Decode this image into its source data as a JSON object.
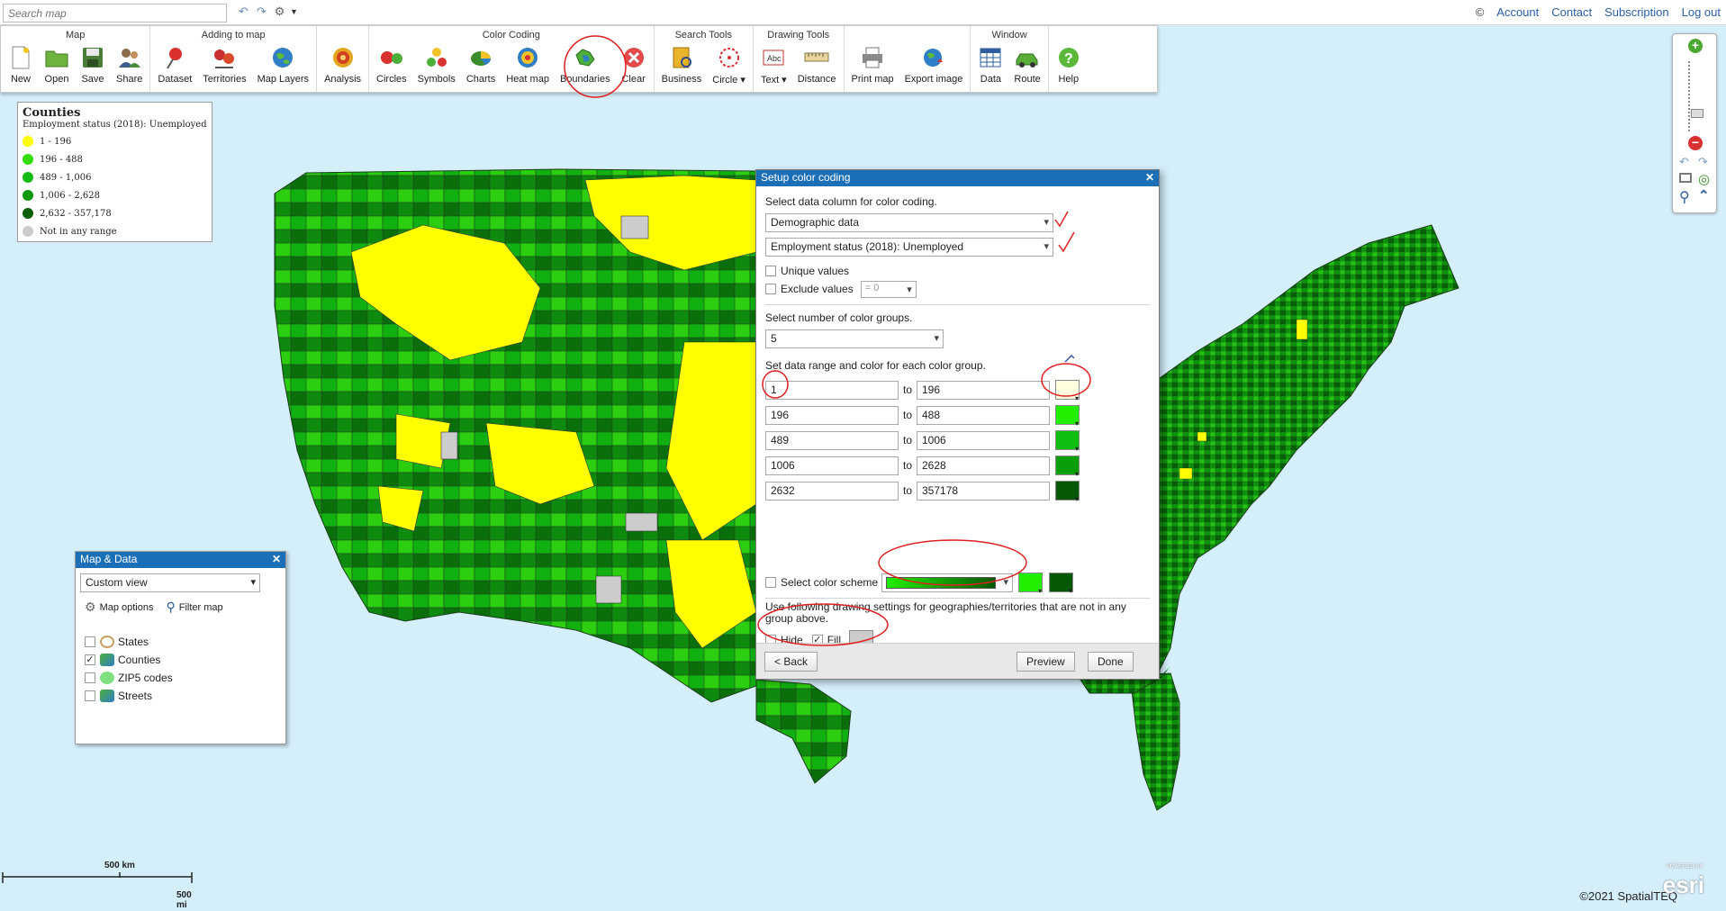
{
  "topbar": {
    "search_placeholder": "Search map",
    "copyright_symbol": "©",
    "links": [
      "Account",
      "Contact",
      "Subscription",
      "Log out"
    ]
  },
  "ribbon": {
    "groups": [
      {
        "title": "Map",
        "buttons": [
          "New",
          "Open",
          "Save",
          "Share"
        ]
      },
      {
        "title": "Adding to map",
        "buttons": [
          "Dataset",
          "Territories",
          "Map Layers"
        ]
      },
      {
        "title": "",
        "buttons": [
          "Analysis"
        ]
      },
      {
        "title": "Color Coding",
        "buttons": [
          "Circles",
          "Symbols",
          "Charts",
          "Heat map",
          "Boundaries",
          "Clear"
        ]
      },
      {
        "title": "Search Tools",
        "buttons": [
          "Business",
          "Circle ▾"
        ]
      },
      {
        "title": "Drawing Tools",
        "buttons": [
          "Text ▾",
          "Distance"
        ]
      },
      {
        "title": "",
        "buttons": [
          "Print map",
          "Export image"
        ]
      },
      {
        "title": "Window",
        "buttons": [
          "Data",
          "Route"
        ]
      },
      {
        "title": "",
        "buttons": [
          "Help"
        ]
      }
    ]
  },
  "legend": {
    "title": "Counties",
    "subtitle": "Employment status (2018): Unemployed",
    "items": [
      {
        "label": "1 - 196",
        "color": "#ffff00"
      },
      {
        "label": "196 - 488",
        "color": "#33dd00"
      },
      {
        "label": "489 - 1,006",
        "color": "#12bb12"
      },
      {
        "label": "1,006 - 2,628",
        "color": "#0b9a0b"
      },
      {
        "label": "2,632 - 357,178",
        "color": "#075e07"
      },
      {
        "label": "Not in any range",
        "color": "#cccccc"
      }
    ]
  },
  "map_data_panel": {
    "title": "Map & Data",
    "close": "✕",
    "view": "Custom view",
    "map_options": "Map options",
    "filter_map": "Filter map",
    "layers": [
      {
        "label": "States",
        "checked": false
      },
      {
        "label": "Counties",
        "checked": true
      },
      {
        "label": "ZIP5 codes",
        "checked": false
      },
      {
        "label": "Streets",
        "checked": false
      }
    ],
    "check_mark": "✓"
  },
  "dialog": {
    "title": "Setup color coding",
    "close": "✕",
    "select_column_label": "Select data column for color coding.",
    "data_source": "Demographic data",
    "data_column": "Employment status (2018): Unemployed",
    "unique_values": "Unique values",
    "exclude_values": "Exclude values",
    "exclude_operator": "= 0",
    "num_groups_label": "Select number of color groups.",
    "num_groups": "5",
    "range_label": "Set data range and color for each color group.",
    "to_label": "to",
    "ranges": [
      {
        "from": "1",
        "to": "196",
        "color": "#ffffe0"
      },
      {
        "from": "196",
        "to": "488",
        "color": "#22ee00"
      },
      {
        "from": "489",
        "to": "1006",
        "color": "#10c010"
      },
      {
        "from": "1006",
        "to": "2628",
        "color": "#0a9e0a"
      },
      {
        "from": "2632",
        "to": "357178",
        "color": "#065806"
      }
    ],
    "color_scheme_label": "Select color scheme",
    "scheme_start_color": "#22ee00",
    "scheme_end_color": "#065806",
    "not_in_group_text": "Use following drawing settings for geographies/territories that are not in any group above.",
    "hide_label": "Hide",
    "fill_label": "Fill",
    "fill_checked": true,
    "fill_color": "#cccccc",
    "back_button": "< Back",
    "preview_button": "Preview",
    "done_button": "Done"
  },
  "map": {
    "scale_km": "500 km",
    "scale_mi": "500 mi",
    "copyright": "©2021 SpatialTEQ",
    "esri_logo": "esri",
    "esri_powered": "POWERED BY"
  }
}
